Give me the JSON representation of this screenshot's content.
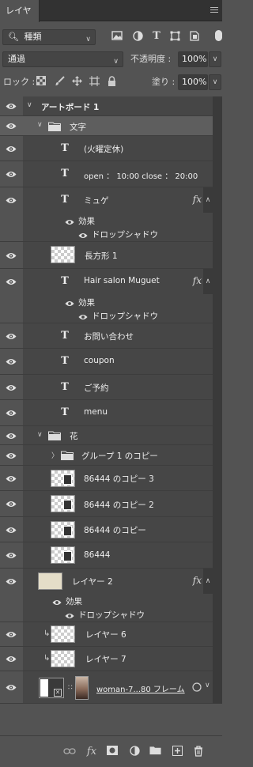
{
  "panel": {
    "tab_label": "レイヤー"
  },
  "filter": {
    "kind_label": "種類"
  },
  "blend": {
    "mode": "通過",
    "opacity_label": "不透明度 :",
    "opacity_value": "100%"
  },
  "lock": {
    "label": "ロック :",
    "fill_label": "塗り :",
    "fill_value": "100%"
  },
  "layers": {
    "artboard": "アートボード 1",
    "group_text": "文字",
    "t1": "(火曜定休)",
    "t2": "open ： 10:00 close ： 20:00",
    "t3": "ミュゲ",
    "t3_effects": "効果",
    "t3_shadow": "ドロップシャドウ",
    "rect": "長方形 1",
    "t4": "Hair salon Muguet",
    "t4_effects": "効果",
    "t4_shadow": "ドロップシャドウ",
    "t5": "お問い合わせ",
    "t6": "coupon",
    "t7": "ご予約",
    "t8": "menu",
    "group_flower": "花",
    "group_copy": "グループ 1 のコピー",
    "f1": "86444 のコピー 3",
    "f2": "86444 のコピー 2",
    "f3": "86444 のコピー",
    "f4": "86444",
    "layer2": "レイヤー 2",
    "layer2_effects": "効果",
    "layer2_shadow": "ドロップシャドウ",
    "layer6": "レイヤー 6",
    "layer7": "レイヤー 7",
    "woman": "woman-7...80 フレーム"
  },
  "fx_label": "fx",
  "colors": {
    "panel_bg": "#535353",
    "list_bg": "#464646",
    "selected_row": "#5e5e5e",
    "tab_bar": "#323232"
  }
}
